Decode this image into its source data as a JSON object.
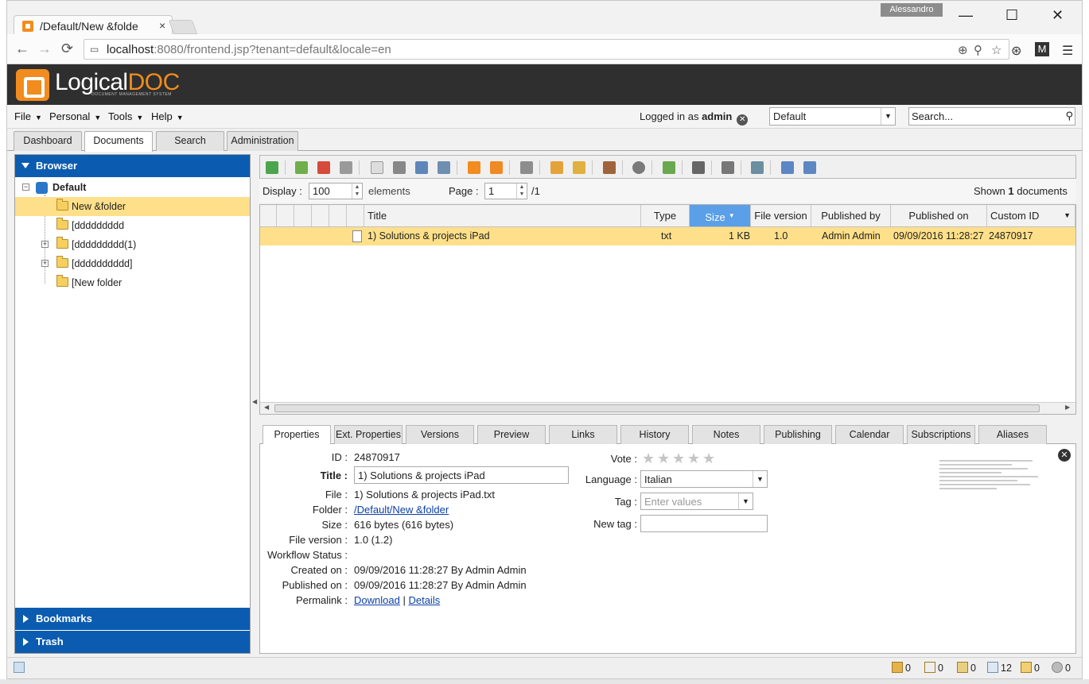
{
  "browser": {
    "tab_title": "/Default/New &folde",
    "tab_close": "×",
    "user_badge": "Alessandro",
    "min": "—",
    "max": "☐",
    "close": "✕",
    "url_host": "localhost",
    "url_rest": ":8080/frontend.jsp?tenant=default&locale=en"
  },
  "header": {
    "logo_a": "Logical",
    "logo_b": "DOC",
    "logo_sub": "DOCUMENT MANAGEMENT SYSTEM"
  },
  "menubar": {
    "items": [
      "File",
      "Personal",
      "Tools",
      "Help"
    ],
    "logged_prefix": "Logged in as",
    "logged_user": "admin",
    "workspace": "Default",
    "search_placeholder": "Search..."
  },
  "main_tabs": [
    "Dashboard",
    "Documents",
    "Search",
    "Administration"
  ],
  "browser_panel": {
    "title": "Browser",
    "root": "Default",
    "folders": [
      "New &folder",
      "[ddddddddd",
      "[ddddddddd(1)",
      "[dddddddddd]",
      "[New folder"
    ],
    "bookmarks": "Bookmarks",
    "trash": "Trash"
  },
  "pager": {
    "display_label": "Display :",
    "display_value": "100",
    "elements_label": "elements",
    "page_label": "Page :",
    "page_value": "1",
    "page_total": "/1",
    "shown_prefix": "Shown",
    "shown_count": "1",
    "shown_suffix": "documents"
  },
  "grid": {
    "columns": [
      "Title",
      "Type",
      "Size",
      "File version",
      "Published by",
      "Published on",
      "Custom ID"
    ],
    "rows": [
      {
        "title": "1) Solutions & projects iPad",
        "type": "txt",
        "size": "1 KB",
        "version": "1.0",
        "published_by": "Admin Admin",
        "published_on": "09/09/2016 11:28:27",
        "custom_id": "24870917"
      }
    ]
  },
  "detail_tabs": [
    "Properties",
    "Ext. Properties",
    "Versions",
    "Preview",
    "Links",
    "History",
    "Notes",
    "Publishing",
    "Calendar",
    "Subscriptions",
    "Aliases"
  ],
  "properties": {
    "id_label": "ID :",
    "id": "24870917",
    "title_label": "Title :",
    "title": "1) Solutions & projects iPad",
    "file_label": "File :",
    "file": "1) Solutions & projects iPad.txt",
    "folder_label": "Folder :",
    "folder": "/Default/New &folder",
    "size_label": "Size :",
    "size": "616 bytes (616 bytes)",
    "version_label": "File version :",
    "version": "1.0 (1.2)",
    "workflow_label": "Workflow Status :",
    "created_label": "Created on :",
    "created": "09/09/2016 11:28:27 By Admin Admin",
    "published_label": "Published on :",
    "published": "09/09/2016 11:28:27 By Admin Admin",
    "permalink_label": "Permalink :",
    "download": "Download",
    "sep": "|",
    "details": "Details",
    "vote_label": "Vote :",
    "language_label": "Language :",
    "language": "Italian",
    "tag_label": "Tag :",
    "tag_placeholder": "Enter values",
    "newtag_label": "New tag :"
  },
  "status": {
    "clipboard": "0",
    "locked": "0",
    "checked_out": "0",
    "messages": "12",
    "tasks": "0",
    "cron": "0"
  }
}
